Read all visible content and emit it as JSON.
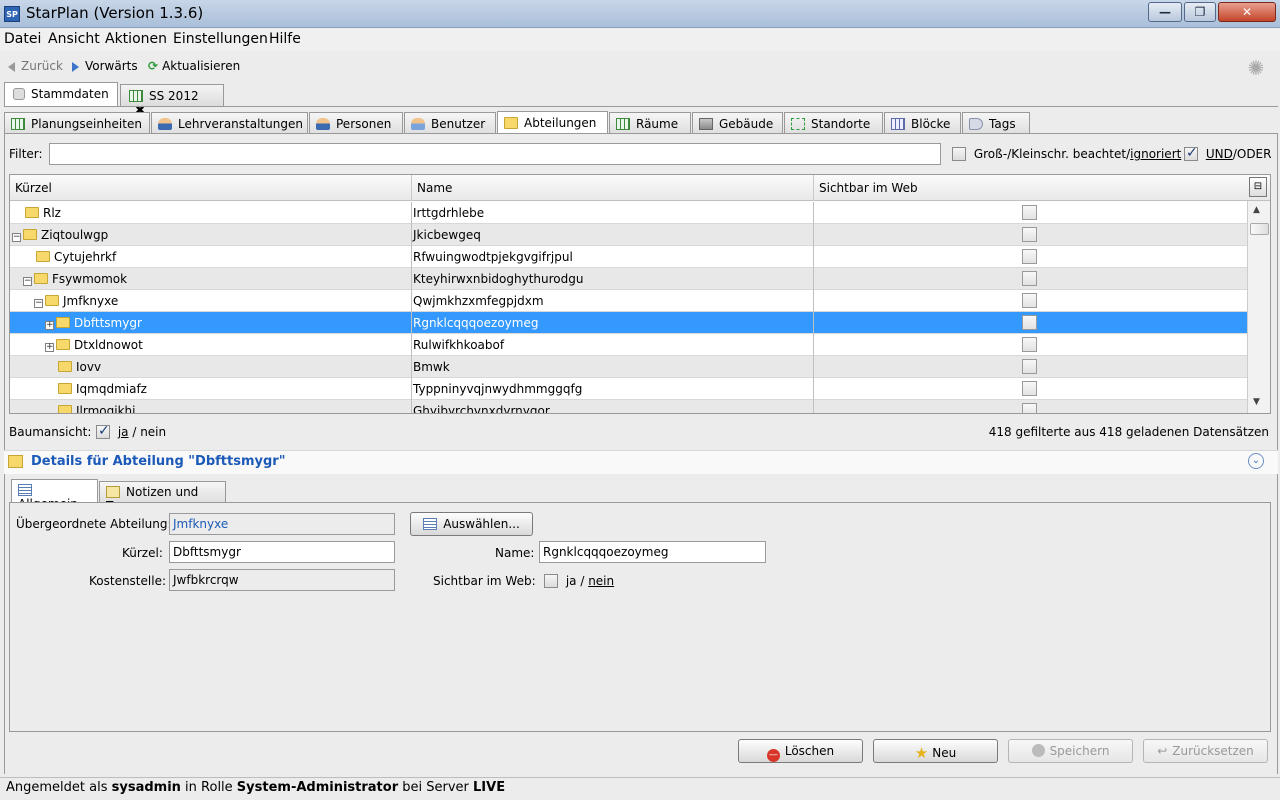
{
  "window": {
    "title": "StarPlan (Version 1.3.6)",
    "icon_text": "SP"
  },
  "menu": [
    "Datei",
    "Ansicht",
    "Aktionen",
    "Einstellungen",
    "Hilfe"
  ],
  "toolbar": {
    "back": "Zurück",
    "forward": "Vorwärts",
    "refresh": "Aktualisieren"
  },
  "top_tabs": [
    "Stammdaten",
    "SS 2012"
  ],
  "sub_tabs": [
    {
      "label": "Planungseinheiten",
      "icon": "grid-icon"
    },
    {
      "label": "Lehrveranstaltungen",
      "icon": "person-icon"
    },
    {
      "label": "Personen",
      "icon": "person-icon"
    },
    {
      "label": "Benutzer",
      "icon": "user-icon"
    },
    {
      "label": "Abteilungen",
      "icon": "folder-icon"
    },
    {
      "label": "Räume",
      "icon": "grid-icon"
    },
    {
      "label": "Gebäude",
      "icon": "building-icon"
    },
    {
      "label": "Standorte",
      "icon": "arrows-icon"
    },
    {
      "label": "Blöcke",
      "icon": "calendar-icon"
    },
    {
      "label": "Tags",
      "icon": "tag-icon"
    }
  ],
  "filter": {
    "label": "Filter:",
    "value": "",
    "case_option": "Groß-/Kleinschr. beachtet/",
    "case_option_underlined": "ignoriert",
    "und_oder_underlined": "UND",
    "und_oder_rest": "/ODER"
  },
  "table": {
    "columns": [
      "Kürzel",
      "Name",
      "Sichtbar im Web"
    ],
    "rows": [
      {
        "kuerzel": "Rlz",
        "name": "Irttgdrhlebe",
        "indent": 0,
        "expander": "",
        "selected": false
      },
      {
        "kuerzel": "Ziqtoulwgp",
        "name": "Jkicbewgeq",
        "indent": 0,
        "expander": "−",
        "selected": false
      },
      {
        "kuerzel": "Cytujehrkf",
        "name": "Rfwuingwodtpjekgvgifrjpul",
        "indent": 1,
        "expander": "",
        "selected": false
      },
      {
        "kuerzel": "Fsywmomok",
        "name": "Kteyhirwxnbidoghythurodgu",
        "indent": 1,
        "expander": "−",
        "selected": false
      },
      {
        "kuerzel": "Jmfknyxe",
        "name": "Qwjmkhzxmfegpjdxm",
        "indent": 2,
        "expander": "−",
        "selected": false
      },
      {
        "kuerzel": "Dbfttsmygr",
        "name": "Rgnklcqqqoezoymeg",
        "indent": 3,
        "expander": "+",
        "selected": true
      },
      {
        "kuerzel": "Dtxldnowot",
        "name": "Rulwifkhkoabof",
        "indent": 3,
        "expander": "+",
        "selected": false
      },
      {
        "kuerzel": "Iovv",
        "name": "Bmwk",
        "indent": 3,
        "expander": "",
        "selected": false
      },
      {
        "kuerzel": "Iqmqdmiafz",
        "name": "Typpninyvqjnwydhmmggqfg",
        "indent": 3,
        "expander": "",
        "selected": false
      },
      {
        "kuerzel": "Jlrmoqikhj",
        "name": "Ghyibyrchvnxdyrnygor",
        "indent": 3,
        "expander": "",
        "selected": false
      }
    ]
  },
  "tree_view": {
    "label": "Baumansicht:",
    "ja": "ja",
    "sep": " / ",
    "nein": "nein"
  },
  "count_text": "418 gefilterte aus 418 geladenen Datensätzen",
  "details": {
    "title": "Details für Abteilung \"Dbfttsmygr\"",
    "tabs": [
      "Allgemein",
      "Notizen und Tags"
    ],
    "parent_label": "Übergeordnete Abteilung:",
    "parent_value": "Jmfknyxe",
    "select_button": "Auswählen...",
    "kuerzel_label": "Kürzel:",
    "kuerzel_value": "Dbfttsmygr",
    "name_label": "Name:",
    "name_value": "Rgnklcqqqoezoymeg",
    "kosten_label": "Kostenstelle:",
    "kosten_value": "Jwfbkrcrqw",
    "web_label": "Sichtbar im Web:",
    "web_ja": "ja",
    "web_sep": " / ",
    "web_nein": "nein"
  },
  "actions": {
    "delete": "Löschen",
    "new": "Neu",
    "save": "Speichern",
    "reset": "Zurücksetzen"
  },
  "status": {
    "prefix": "Angemeldet als ",
    "user": "sysadmin",
    "mid": " in Rolle ",
    "role": "System-Administrator",
    "mid2": " bei Server ",
    "server": "LIVE"
  },
  "colors": {
    "selection": "#3399ff",
    "link": "#1b5ab8"
  }
}
